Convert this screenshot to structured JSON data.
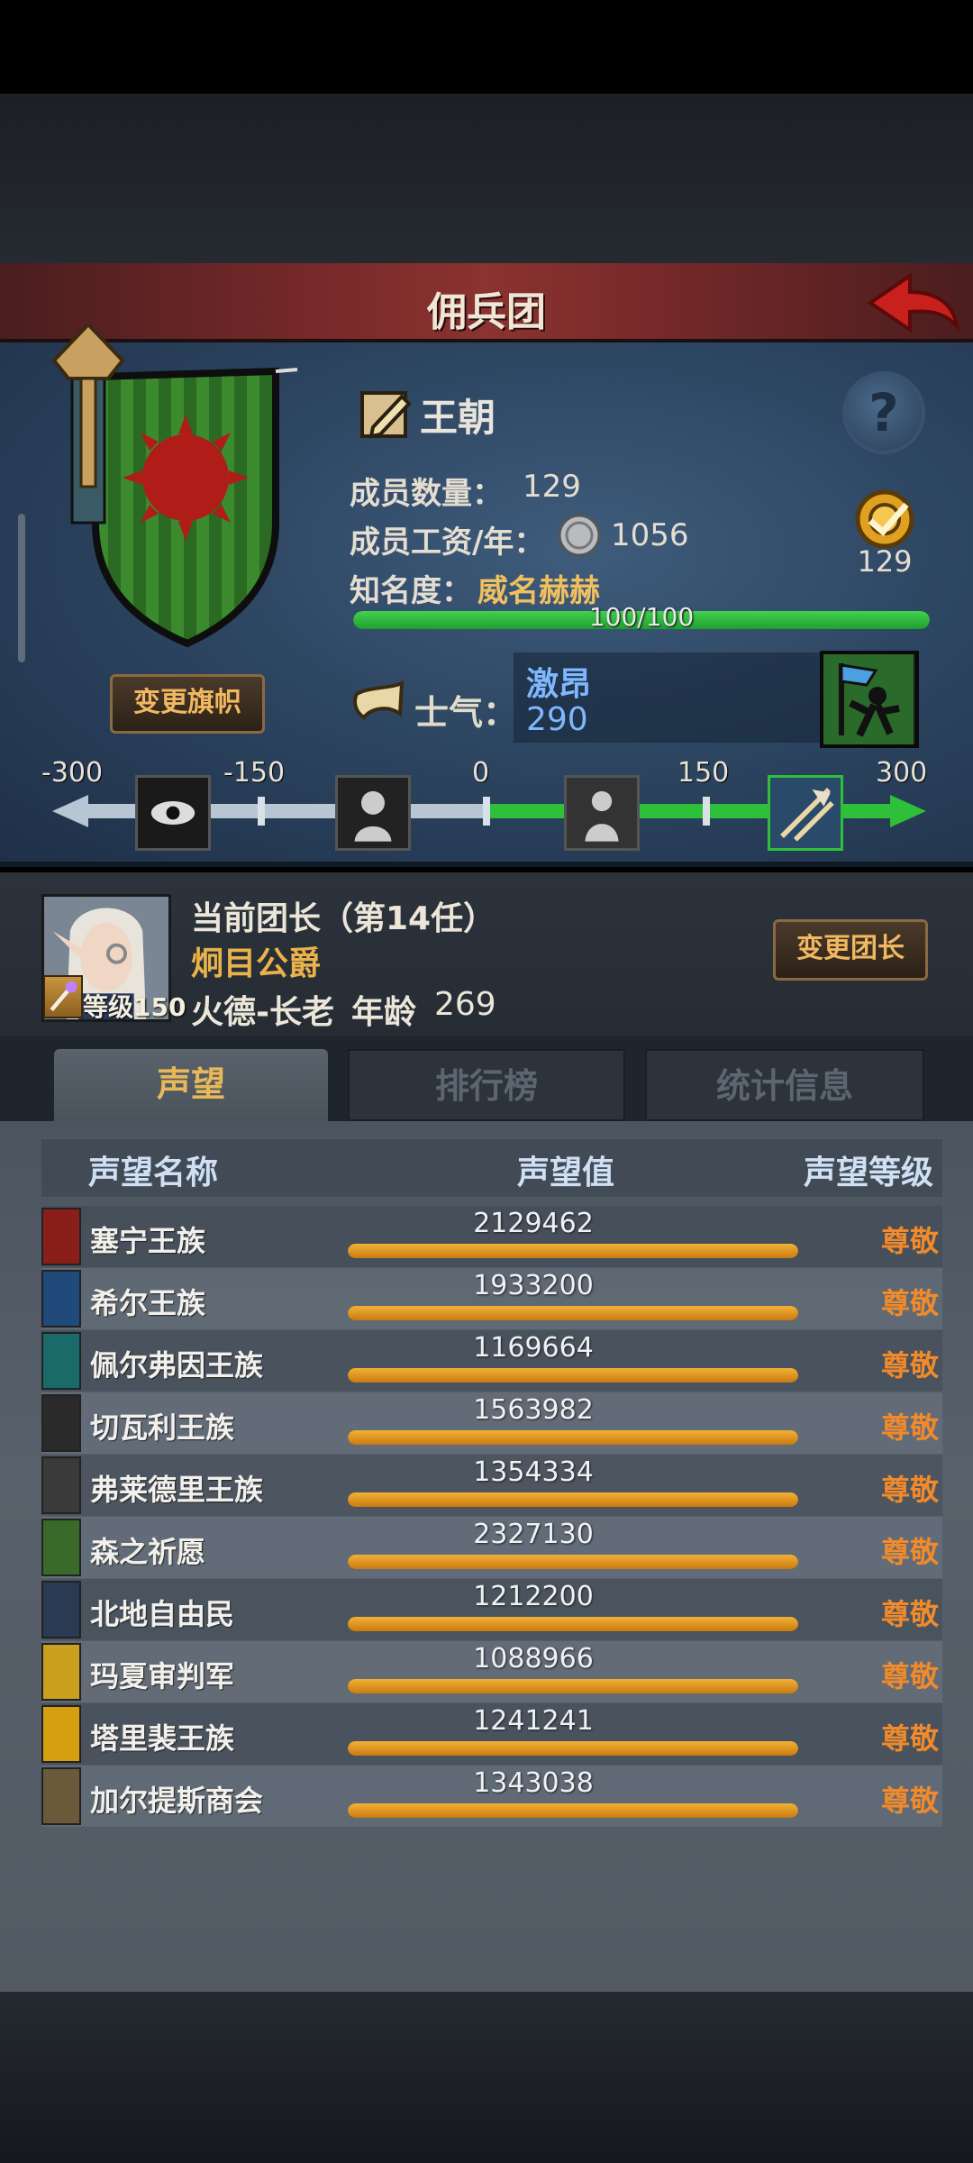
{
  "title": "佣兵团",
  "guild": {
    "name": "王朝",
    "member_count_label": "成员数量：",
    "member_count": "129",
    "salary_label": "成员工资/年：",
    "salary": "1056",
    "fame_label": "知名度：",
    "fame_value": "威名赫赫",
    "fame_progress_text": "100/100",
    "fame_progress": 1.0,
    "target_value": "129",
    "change_banner_label": "变更旗帜",
    "morale_label": "士气：",
    "morale_state": "激昂",
    "morale_value": "290",
    "morale_scale": [
      "-300",
      "-150",
      "0",
      "150",
      "300"
    ]
  },
  "leader": {
    "title": "当前团长（第14任）",
    "name": "炯目公爵",
    "level_text": "等级150",
    "race": "火德-长老",
    "age_label": "年龄",
    "age": "269",
    "change_leader_label": "变更团长"
  },
  "tabs": [
    {
      "label": "声望",
      "active": true
    },
    {
      "label": "排行榜",
      "active": false
    },
    {
      "label": "统计信息",
      "active": false
    }
  ],
  "reputation": {
    "headers": {
      "name": "声望名称",
      "value": "声望值",
      "level": "声望等级"
    },
    "rows": [
      {
        "name": "塞宁王族",
        "value": "2129462",
        "level": "尊敬",
        "icon_color": "#8a1f1a"
      },
      {
        "name": "希尔王族",
        "value": "1933200",
        "level": "尊敬",
        "icon_color": "#1f4a7a"
      },
      {
        "name": "佩尔弗因王族",
        "value": "1169664",
        "level": "尊敬",
        "icon_color": "#1a6a6a"
      },
      {
        "name": "切瓦利王族",
        "value": "1563982",
        "level": "尊敬",
        "icon_color": "#2a2a2a"
      },
      {
        "name": "弗莱德里王族",
        "value": "1354334",
        "level": "尊敬",
        "icon_color": "#3a3a3a"
      },
      {
        "name": "森之祈愿",
        "value": "2327130",
        "level": "尊敬",
        "icon_color": "#3a6a2a"
      },
      {
        "name": "北地自由民",
        "value": "1212200",
        "level": "尊敬",
        "icon_color": "#2a3a52"
      },
      {
        "name": "玛夏审判军",
        "value": "1088966",
        "level": "尊敬",
        "icon_color": "#c9a020"
      },
      {
        "name": "塔里裴王族",
        "value": "1241241",
        "level": "尊敬",
        "icon_color": "#d4a010"
      },
      {
        "name": "加尔提斯商会",
        "value": "1343038",
        "level": "尊敬",
        "icon_color": "#6a5a3a"
      }
    ]
  }
}
